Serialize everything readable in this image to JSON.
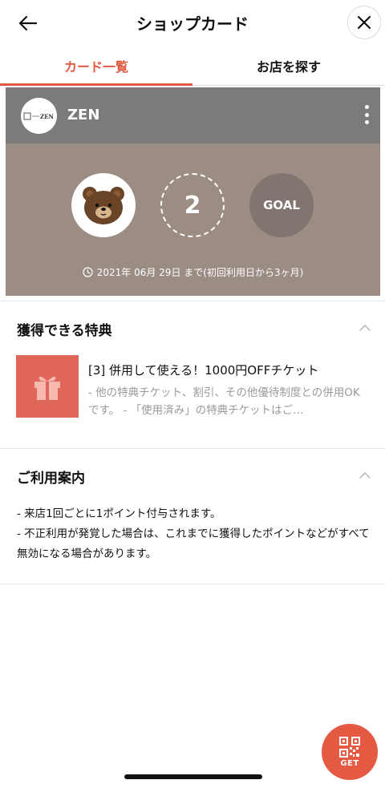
{
  "header": {
    "title": "ショップカード",
    "back_icon": "arrow-left-icon",
    "close_icon": "close-icon"
  },
  "tabs": [
    {
      "label": "カード一覧",
      "active": true
    },
    {
      "label": "お店を探す",
      "active": false
    }
  ],
  "card": {
    "shop_logo_text": "ZEN",
    "shop_name": "ZEN",
    "points": "2",
    "goal_label": "GOAL",
    "expiry_text": "2021年 06月 29日 まで(初回利用日から3ヶ月)",
    "colors": {
      "header": "#7b7b7b",
      "body": "#9c8d84"
    }
  },
  "benefits_section": {
    "title": "獲得できる特典",
    "items": [
      {
        "title": "[3] 併用して使える！1000円OFFチケット",
        "description": "- 他の特典チケット、割引、その他優待制度との併用OKです。 - 「使用済み」の特典チケットはご…"
      }
    ]
  },
  "guide_section": {
    "title": "ご利用案内",
    "lines": [
      "- 来店1回ごとに1ポイント付与されます。",
      "- 不正利用が発覚した場合は、これまでに獲得したポイントなどがすべて無効になる場合があります。"
    ]
  },
  "get_button": {
    "label": "GET",
    "icon": "qr-code-icon"
  },
  "accent_color": "#e0573f"
}
